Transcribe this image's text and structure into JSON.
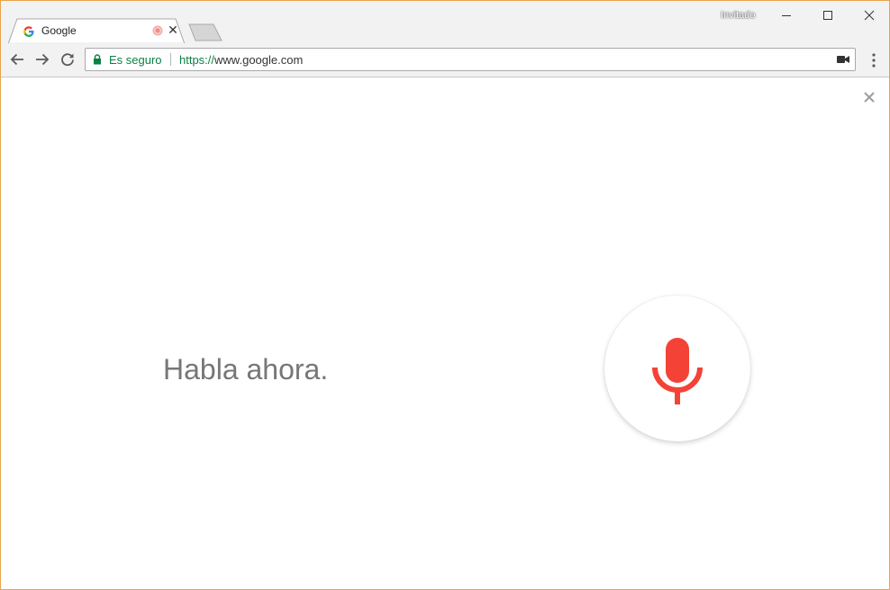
{
  "window": {
    "profile_name": "Invitado"
  },
  "tab": {
    "title": "Google",
    "favicon": "google-g-icon",
    "recording_indicator": "recording-dot-icon",
    "close_glyph": "✕"
  },
  "toolbar": {
    "back_icon": "arrow-left-icon",
    "forward_icon": "arrow-right-icon",
    "reload_icon": "reload-icon",
    "menu_icon": "vertical-dots-icon"
  },
  "omnibox": {
    "secure_label": "Es seguro",
    "url_scheme": "https://",
    "url_rest": "www.google.com",
    "camera_icon": "video-camera-icon"
  },
  "voice_search": {
    "prompt": "Habla ahora.",
    "mic_icon": "microphone-icon",
    "dismiss_icon": "close-icon"
  },
  "colors": {
    "secure_green": "#0b8043",
    "mic_red": "#f44336",
    "prompt_gray": "#777777",
    "frame_border": "#e8a54a"
  }
}
